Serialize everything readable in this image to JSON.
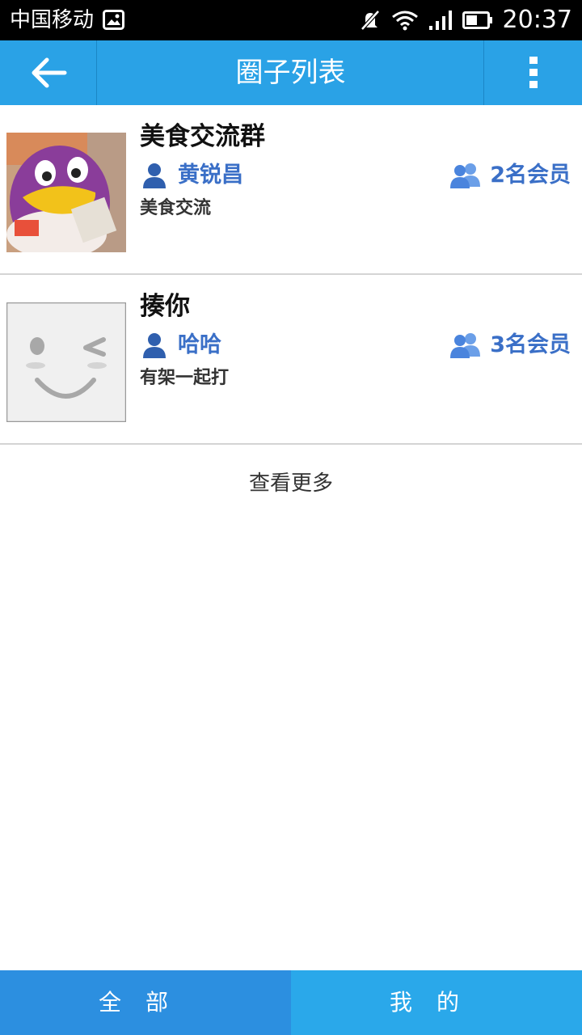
{
  "statusbar": {
    "carrier": "中国移动",
    "time": "20:37",
    "icons": [
      "gallery-icon",
      "mute-icon",
      "wifi-icon",
      "signal-icon",
      "battery-icon"
    ]
  },
  "titlebar": {
    "title": "圈子列表",
    "back_icon": "back-arrow-icon",
    "menu_icon": "overflow-menu-icon",
    "bg_color": "#2aa2e6"
  },
  "circles": [
    {
      "name": "美食交流群",
      "owner": "黄锐昌",
      "members": "2名会员",
      "description": "美食交流",
      "thumbnail": "penguin-photo"
    },
    {
      "name": "揍你",
      "owner": "哈哈",
      "members": "3名会员",
      "description": "有架一起打",
      "thumbnail": "wink-face-placeholder"
    }
  ],
  "load_more": "查看更多",
  "tabs": {
    "all": "全部",
    "mine": "我的"
  },
  "colors": {
    "accent": "#2aa2e6",
    "link_text": "#3a6fc7"
  }
}
